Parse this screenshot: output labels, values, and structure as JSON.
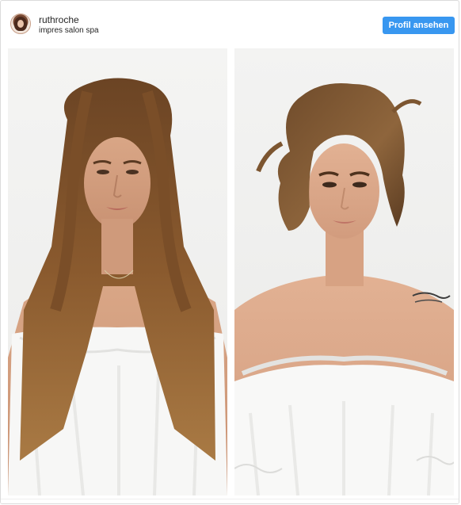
{
  "post": {
    "username": "ruthroche",
    "location": "impres salon spa",
    "profile_button_label": "Profil ansehen"
  },
  "colors": {
    "button_blue": "#3897f0",
    "text_dark": "#262626",
    "border": "#dbdbdb"
  },
  "images": {
    "before_icon": "before-photo-long-hair",
    "after_icon": "after-photo-short-hair"
  }
}
